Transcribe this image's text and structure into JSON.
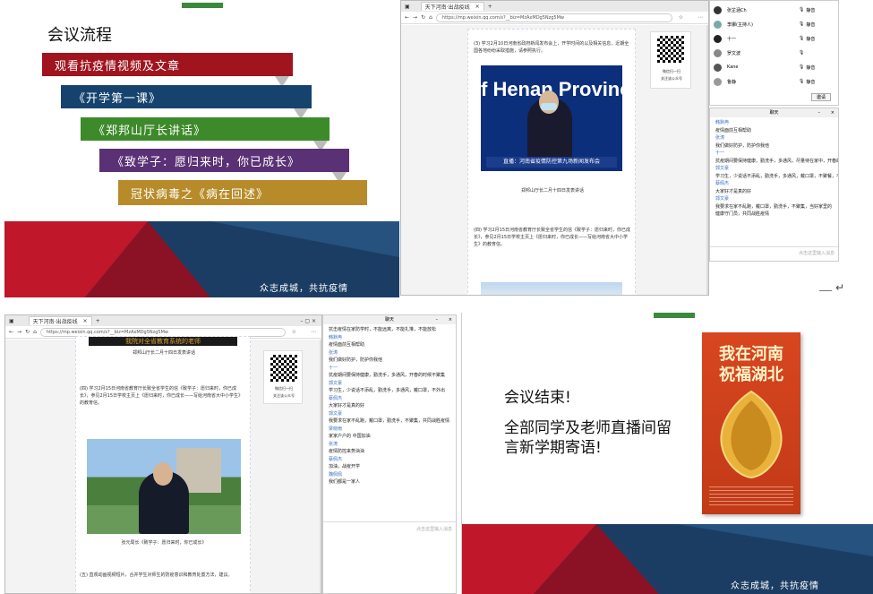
{
  "slide1": {
    "tiny_bar": "",
    "title": "会议流程",
    "items": [
      {
        "label": "观看抗疫情视频及文章",
        "color": "#a0141e"
      },
      {
        "label": "《开学第一课》",
        "color": "#16436e"
      },
      {
        "label": "《郑邦山厅长讲话》",
        "color": "#3d8a2a"
      },
      {
        "label": "《致学子：愿归来时，你已成长》",
        "color": "#5b3175"
      },
      {
        "label": "冠状病毒之《病在回述》",
        "color": "#b78b2a"
      }
    ],
    "slogan": "众志成城，共抗疫情"
  },
  "browser_top": {
    "tab_label": "天下河南·出战疫线",
    "url": "https://mp.weixin.qq.com/s?__biz=MzAxMDg5Nzg5Mw",
    "para1": "(3) 学习2月10日河南省政府新闻发布会上，开学时间的以及相关信息，近期全国各地纷纷采取措施，请参照执行。",
    "banner_text": "f Henan Provinc",
    "banner_caption": "直播：河南省疫情防控第九场新闻发布会",
    "video_caption": "郑邦山厅长二月十四日发表讲话",
    "qr_caption1": "微信扫一扫",
    "qr_caption2": "关注该公众号",
    "para2": "(四) 学习2月15日河南省教育厅长致全省学生的信《致学子：愿归来时，你已成长》，参见2月15日学校主页上《愿归来时，你已成长——写给河南省大中小学生》的教育信。"
  },
  "participants_top": {
    "people": [
      {
        "name": "张芷涵Ch",
        "status": "静音"
      },
      {
        "name": "李娜(主持人)",
        "status": "静音"
      },
      {
        "name": "十一",
        "status": "静音"
      },
      {
        "name": "罗文波",
        "status": ""
      },
      {
        "name": "Kane",
        "status": "静音"
      },
      {
        "name": "鲁静",
        "status": "静音"
      }
    ],
    "button": "邀请"
  },
  "chat_top": {
    "title": "聊天",
    "messages": [
      {
        "name": "韩默冉",
        "text": "疫情面前互相帮助"
      },
      {
        "name": "张涛",
        "text": "我们做好防护，防护你我他"
      },
      {
        "name": "十一",
        "text": "抗疫期间要保持健康，勤洗手，多通风，尽量待在家中，开春的时候不聚集"
      },
      {
        "name": "郭文豪",
        "text": "学习生，少说话不添乱，勤洗手，多通风，戴口罩，不聚餐，不外出"
      },
      {
        "name": "蔡佩杰",
        "text": "大家好才是真的好"
      },
      {
        "name": "郭文豪",
        "text": "我要求在家不乱跑，戴口罩，勤洗手，不聚集，当好家里的健康守门员，共同战胜疫情"
      }
    ],
    "input_placeholder": "点击这里输入消息"
  },
  "return_glyph": "↵",
  "browser_bottom": {
    "tab_label": "天下河南·出战疫线",
    "url": "https://mp.weixin.qq.com/s?__biz=MzAxMDg5Nzg5Mw",
    "banner_text": "我院对全省教育系统的老师",
    "video_caption_top": "郑邦山厅长二月十四日发表讲话",
    "para1": "(四) 学习2月15日河南省教育厅长致全省学生的信《致学子：愿归来时，你已成长》，参见2月15日学校主页上《愿归来时，你已成长——写给河南省大中小学生》的教育信。",
    "video_caption": "张元局长《致学子：愿归来时，你已成长》",
    "para2": "(五) 直观动画视频短片，合并学生对师生的防疫意识和教育处置方法，建议。",
    "qr_caption1": "微信扫一扫",
    "qr_caption2": "关注该公众号"
  },
  "chat_bottom": {
    "title": "聊天",
    "messages": [
      {
        "name": "",
        "text": "抗击疫情在家防学时，不能远离，不能扎堆，不能放松"
      },
      {
        "name": "韩默冉",
        "text": "疫情面前互相帮助"
      },
      {
        "name": "张涛",
        "text": "我们做好防护，防护你我他"
      },
      {
        "name": "十一",
        "text": "抗疫期间要保持健康，勤洗手，多通风，开春的时候不聚集"
      },
      {
        "name": "郭文豪",
        "text": "学习生，少说话不添乱，勤洗手，多通风，戴口罩，不外出"
      },
      {
        "name": "蔡佩杰",
        "text": "大家好才是真的好"
      },
      {
        "name": "郭文豪",
        "text": "我要求在家不乱跑，戴口罩，勤洗手，不聚集，共同战胜疫情"
      },
      {
        "name": "梁晓雨",
        "text": "家家户户的 中国加油"
      },
      {
        "name": "张涛",
        "text": "疫情防控来势汹汹"
      },
      {
        "name": "蔡佩杰",
        "text": "加油，战疫开学"
      },
      {
        "name": "魏佩佩",
        "text": "我们都是一家人"
      }
    ],
    "input_placeholder": "点击这里输入消息"
  },
  "slide2": {
    "tiny_bar": "",
    "line1": "会议结束!",
    "line2": "全部同学及老师直播间留言新学期寄语!",
    "poster_title1": "我在河南",
    "poster_title2": "祝福湖北",
    "slogan": "众志成城，共抗疫情"
  }
}
